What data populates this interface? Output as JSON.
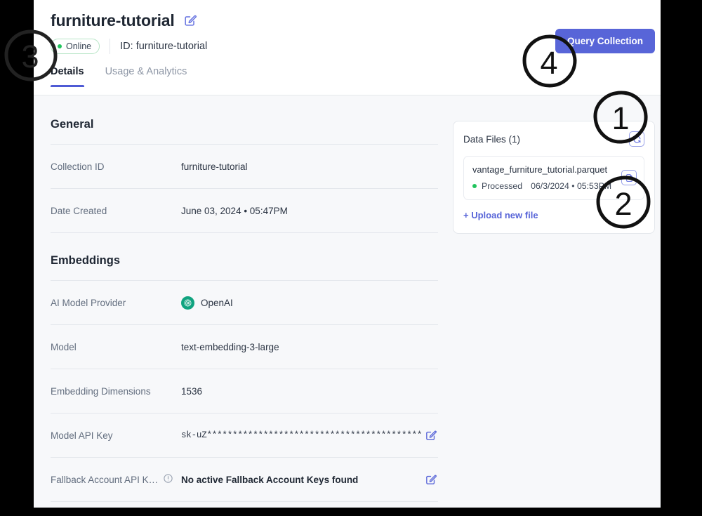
{
  "header": {
    "title": "furniture-tutorial",
    "edit_icon": "edit-square-pencil-icon",
    "status": {
      "label": "Online",
      "color": "#21c45d"
    },
    "collection_id_text": "ID: furniture-tutorial",
    "tabs": [
      {
        "label": "Details",
        "active": true
      },
      {
        "label": "Usage & Analytics",
        "active": false
      }
    ],
    "query_button": {
      "label": "Query Collection",
      "color": "#5865d8"
    }
  },
  "sections": [
    {
      "title": "General",
      "rows": [
        {
          "label": "Collection ID",
          "value": "furniture-tutorial",
          "action": null
        },
        {
          "label": "Date Created",
          "value": "June 03, 2024 • 05:47PM",
          "action": null
        }
      ]
    },
    {
      "title": "Embeddings",
      "rows": [
        {
          "label": "AI Model Provider",
          "value": "OpenAI",
          "icon": "openai-logo-icon",
          "action": null
        },
        {
          "label": "Model",
          "value": "text-embedding-3-large",
          "action": null
        },
        {
          "label": "Embedding Dimensions",
          "value": "1536",
          "action": null
        },
        {
          "label": "Model API Key",
          "value": "sk-uZ*******************************************thY",
          "action": "edit-icon",
          "mono": true
        },
        {
          "label": "Fallback Account API K…",
          "value": "No active Fallback Account Keys found",
          "action": "edit-icon",
          "warn_icon": "info-circle-icon",
          "strong": true
        }
      ]
    }
  ],
  "data_files": {
    "title": "Data Files (1)",
    "refresh_icon": "refresh-icon",
    "files": [
      {
        "name": "vantage_furniture_tutorial.parquet",
        "status": "Processed",
        "date": "06/3/2024 • 05:53PM",
        "status_color": "#21c45d",
        "action_icon": "file-document-icon"
      }
    ],
    "upload_label": "+ Upload new file"
  },
  "annotations": [
    {
      "number": "1"
    },
    {
      "number": "2"
    },
    {
      "number": "3"
    },
    {
      "number": "4"
    }
  ]
}
